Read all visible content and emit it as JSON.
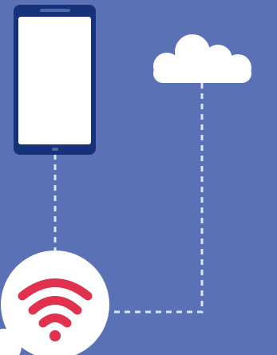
{
  "diagram": {
    "background_color": "#5B71B5",
    "phone": {
      "icon": "smartphone-icon",
      "body_color": "#16327A",
      "screen_color": "#FFFFFF"
    },
    "cloud": {
      "icon": "cloud-icon",
      "color": "#FFFFFF"
    },
    "router": {
      "icon": "wifi-icon",
      "circle_color": "#FFFFFF",
      "signal_color": "#E0314E"
    },
    "connectors": {
      "style": "dashed",
      "color": "#D9E6F7",
      "links": [
        {
          "from": "phone",
          "to": "router"
        },
        {
          "from": "cloud",
          "to": "router"
        }
      ]
    }
  }
}
